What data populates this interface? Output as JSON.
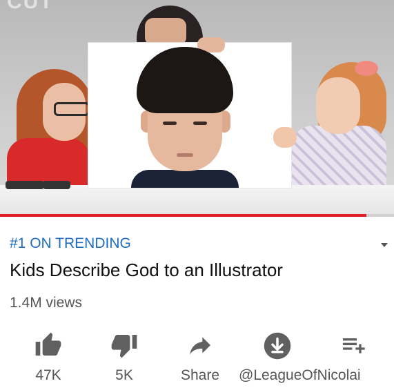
{
  "video": {
    "watermark_text": "CUT"
  },
  "info": {
    "trending_label": "#1 ON TRENDING",
    "title": "Kids Describe God to an Illustrator",
    "views": "1.4M views"
  },
  "actions": {
    "like_count": "47K",
    "dislike_count": "5K",
    "share_label": "Share",
    "download_label": "@LeagueOfNicolai"
  },
  "progress": {
    "watched_fraction": 0.93
  },
  "colors": {
    "trending": "#1e6cc4",
    "progress": "#e02020",
    "icon": "#606060"
  },
  "icons": [
    "thumbs-up-icon",
    "thumbs-down-icon",
    "share-arrow-icon",
    "download-icon",
    "add-to-playlist-icon"
  ]
}
